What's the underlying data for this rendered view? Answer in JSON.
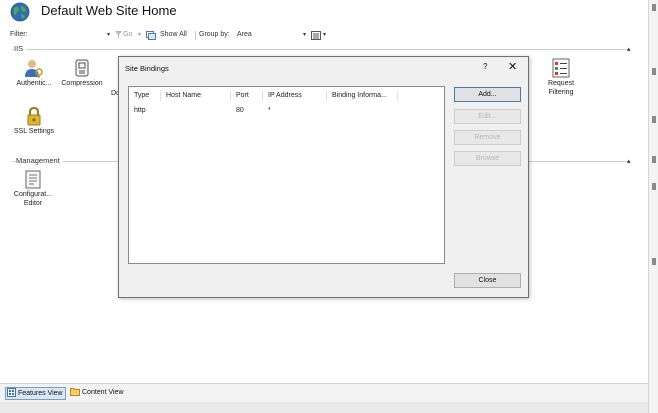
{
  "window": {
    "title": "Default Web Site Home",
    "site_icon": "globe-icon"
  },
  "filter_bar": {
    "filter_label": "Filter:",
    "filter_value": "",
    "go_label": "Go",
    "show_all_label": "Show All",
    "group_by_label": "Group by:",
    "group_by_value": "Area"
  },
  "groups": [
    {
      "name": "IIS"
    },
    {
      "name": "Management"
    }
  ],
  "features": {
    "authentication": {
      "label": "Authentic...",
      "icon": "users-key-icon"
    },
    "compression": {
      "label": "Compression",
      "icon": "compression-icon"
    },
    "default_document_partial": {
      "label": "Dc"
    },
    "request_filtering": {
      "label_line1": "Request",
      "label_line2": "Filtering",
      "icon": "request-filtering-icon"
    },
    "ssl_settings": {
      "label": "SSL Settings",
      "icon": "padlock-icon"
    },
    "configuration_editor": {
      "label_line1": "Configurat...",
      "label_line2": "Editor",
      "icon": "configuration-editor-icon"
    }
  },
  "dialog": {
    "title": "Site Bindings",
    "help_label": "?",
    "close_label": "✕",
    "columns": [
      "Type",
      "Host Name",
      "Port",
      "IP Address",
      "Binding Informa..."
    ],
    "rows": [
      {
        "type": "http",
        "host_name": "",
        "port": "80",
        "ip_address": "*",
        "binding_info": ""
      }
    ],
    "buttons": {
      "add": "Add...",
      "edit": "Edit...",
      "remove": "Remove",
      "browse": "Browse",
      "close": "Close"
    }
  },
  "bottom_tabs": {
    "features_view": "Features View",
    "content_view": "Content View",
    "active": "features_view"
  },
  "colors": {
    "dialog_background": "#f0f0f0",
    "primary_button_border": "#3c7fb1",
    "disabled_text": "#b8b8b8",
    "active_tab_background": "#dbe7f6"
  }
}
